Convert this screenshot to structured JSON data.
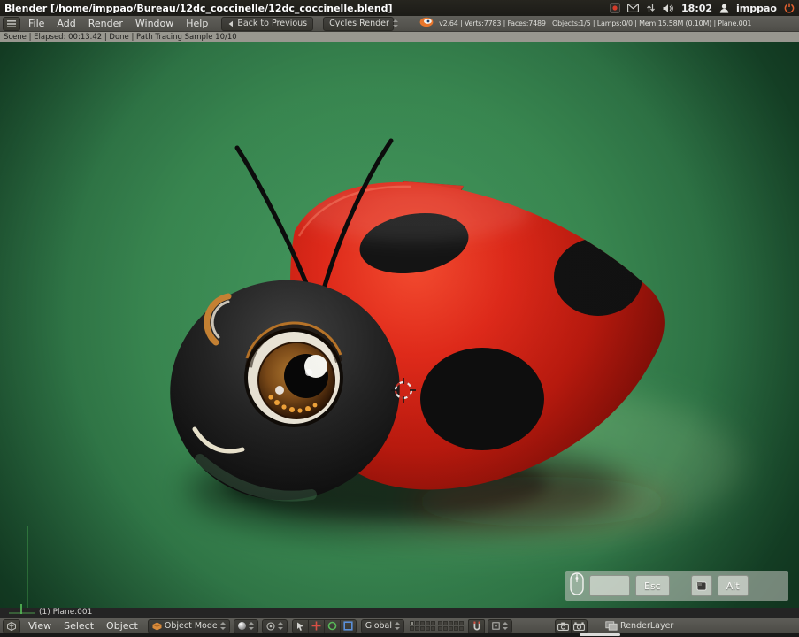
{
  "colors": {
    "ladybug_red": "#d9261a",
    "viewport_green": "#3a8a52",
    "header_gray": "#555450",
    "accent_orange": "#e8762c"
  },
  "titlebar": {
    "title": "Blender [/home/imppao/Bureau/12dc_coccinelle/12dc_coccinelle.blend]",
    "clock": "18:02",
    "username": "imppao"
  },
  "info_header": {
    "menus": [
      "File",
      "Add",
      "Render",
      "Window",
      "Help"
    ],
    "back_button": "Back to Previous",
    "engine": "Cycles Render",
    "stats": "v2.64 | Verts:7783 | Faces:7489 | Objects:1/5 | Lamps:0/0 | Mem:15.58M (0.10M) | Plane.001"
  },
  "status_bar": "Scene | Elapsed: 00:13.42 | Done | Path Tracing Sample 10/10",
  "viewport": {
    "object_info": "(1) Plane.001",
    "screencast_keys": {
      "key1": "Esc",
      "key2": "Alt"
    }
  },
  "view3d_header": {
    "menus": [
      "View",
      "Select",
      "Object"
    ],
    "mode": "Object Mode",
    "orientation": "Global",
    "render_layer": "RenderLayer"
  }
}
